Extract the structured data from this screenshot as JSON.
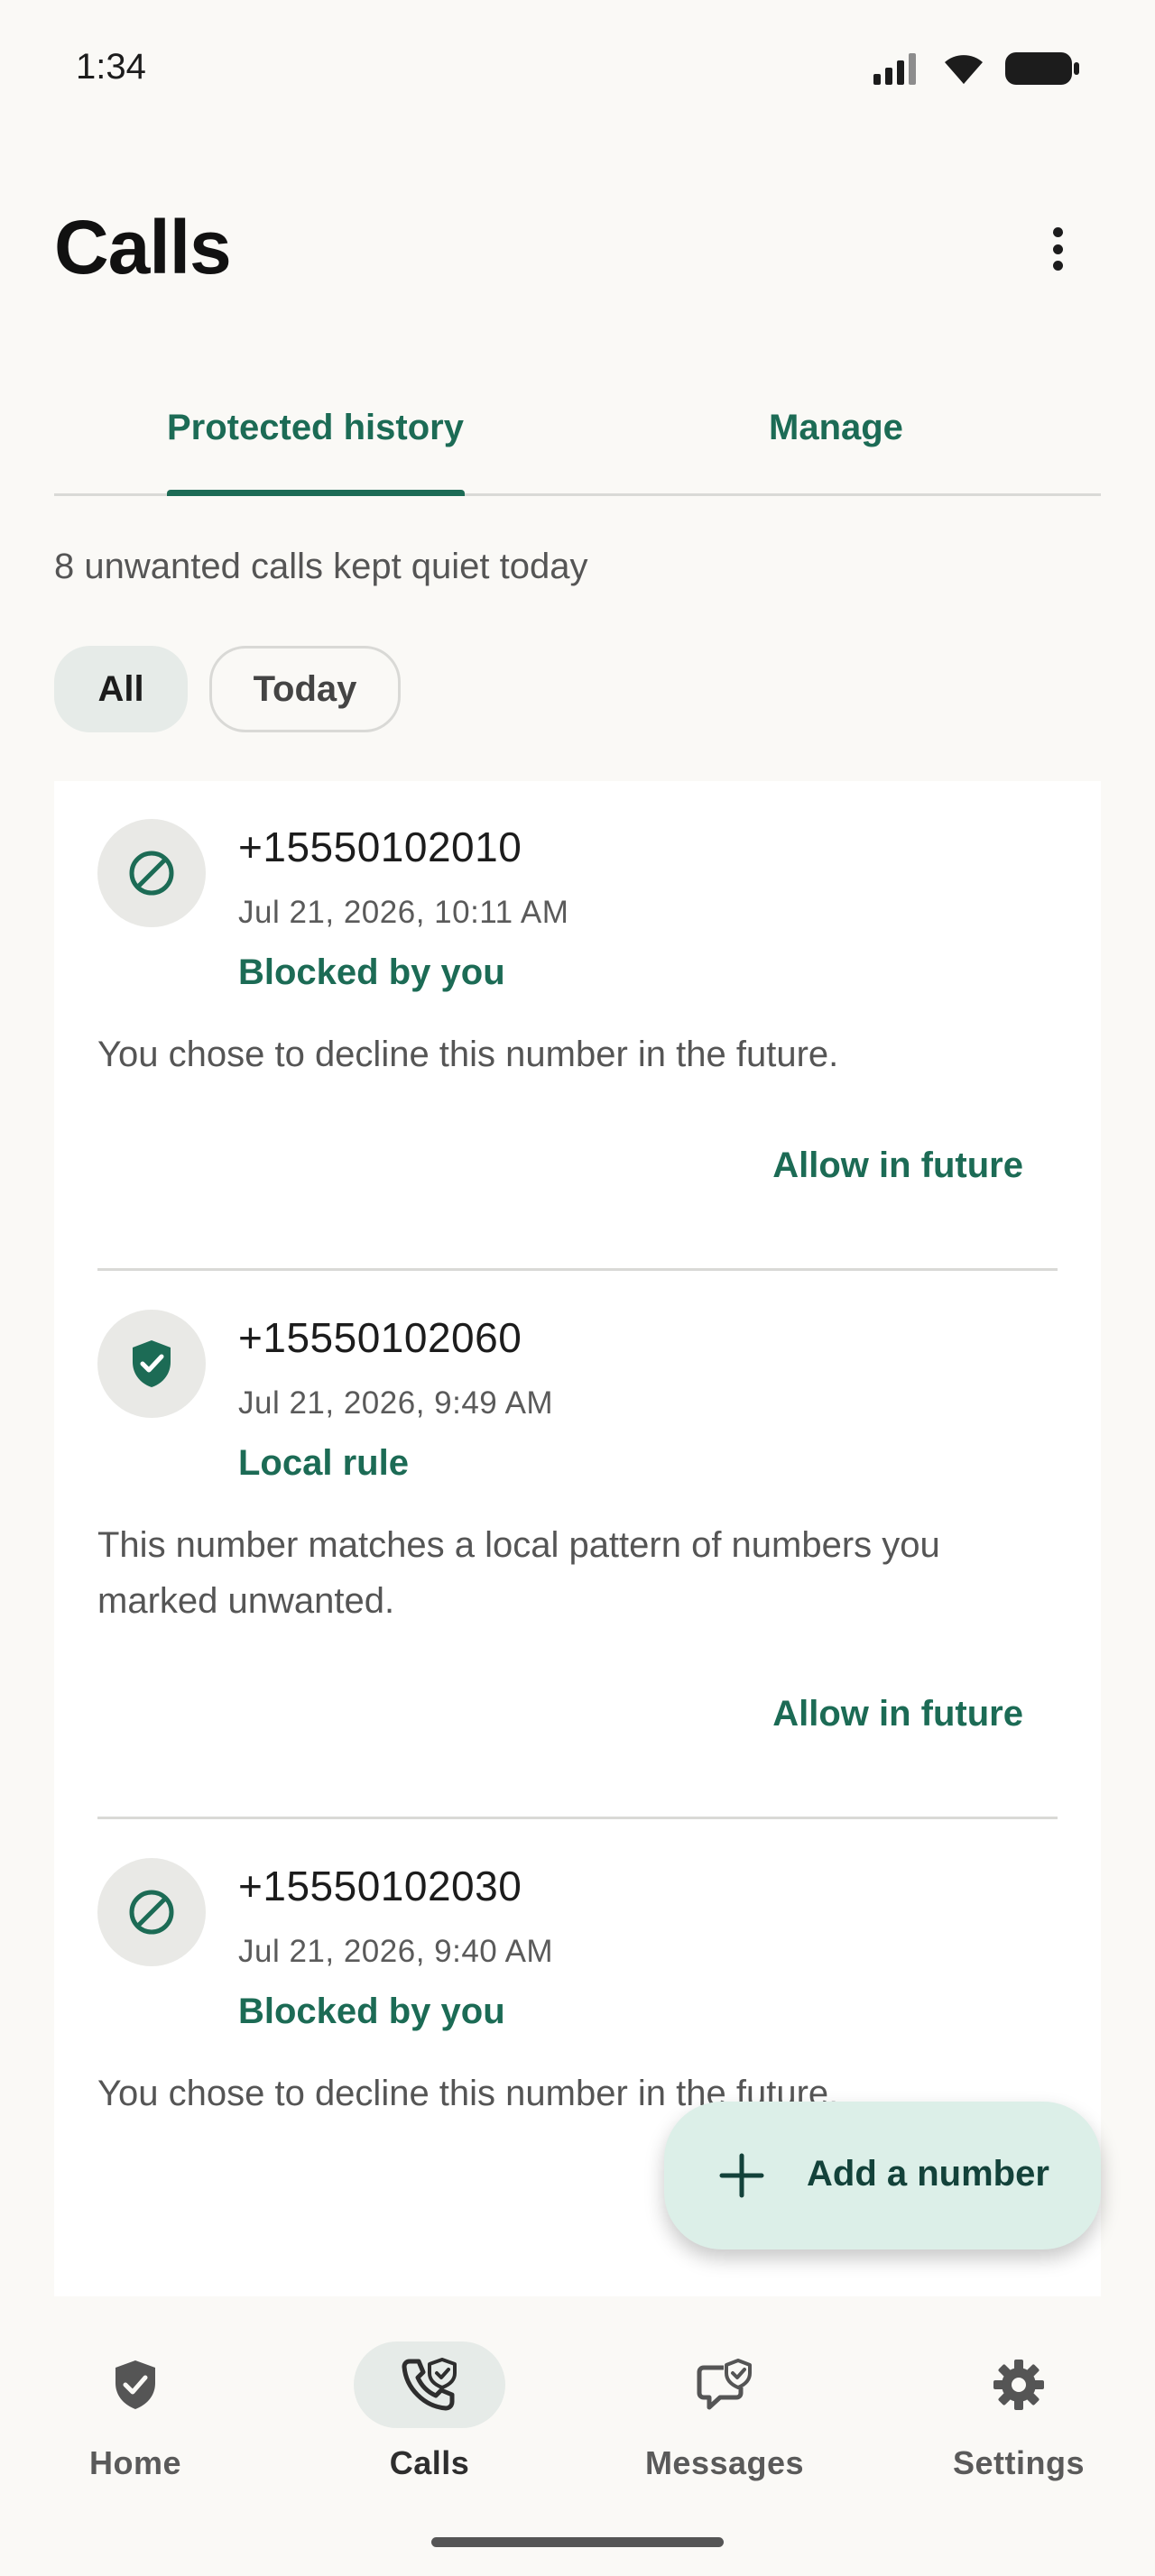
{
  "status_bar": {
    "time": "1:34"
  },
  "header": {
    "title": "Calls"
  },
  "tabs": [
    {
      "label": "Protected history",
      "selected": true
    },
    {
      "label": "Manage",
      "selected": false
    }
  ],
  "summary": "8 unwanted calls kept quiet today",
  "filters": [
    {
      "label": "All",
      "selected": true
    },
    {
      "label": "Today",
      "selected": false
    }
  ],
  "calls": [
    {
      "number": "+15550102010",
      "time": "Jul 21, 2026, 10:11 AM",
      "reason": "Blocked by you",
      "description": "You chose to decline this number in the future.",
      "action": "Allow in future",
      "icon": "block-icon"
    },
    {
      "number": "+15550102060",
      "time": "Jul 21, 2026, 9:49 AM",
      "reason": "Local rule",
      "description": "This number matches a local pattern of numbers you marked unwanted.",
      "action": "Allow in future",
      "icon": "shield-check-icon"
    },
    {
      "number": "+15550102030",
      "time": "Jul 21, 2026, 9:40 AM",
      "reason": "Blocked by you",
      "description": "You chose to decline this number in the future.",
      "icon": "block-icon"
    }
  ],
  "fab": {
    "label": "Add a number",
    "icon": "plus-icon"
  },
  "bottom_nav": [
    {
      "label": "Home",
      "icon": "shield-check-icon",
      "active": false
    },
    {
      "label": "Calls",
      "icon": "phone-shield-icon",
      "active": true
    },
    {
      "label": "Messages",
      "icon": "message-shield-icon",
      "active": false
    },
    {
      "label": "Settings",
      "icon": "gear-icon",
      "active": false
    }
  ],
  "colors": {
    "accent": "#1c6b55",
    "background": "#faf9f6",
    "fab_background": "#dcefe8",
    "chip_selected": "#e6ebe8"
  }
}
